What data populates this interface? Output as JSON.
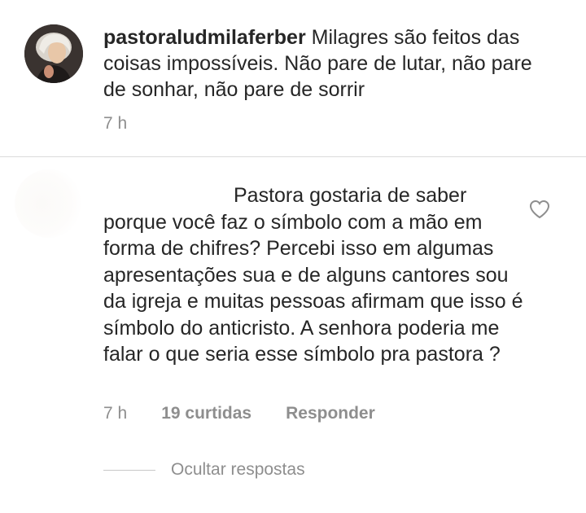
{
  "post": {
    "username": "pastoraludmilaferber",
    "caption": "Milagres são feitos das coisas impossíveis. Não pare de lutar, não pare de sonhar, não pare de sorrir",
    "time": "7 h"
  },
  "comment": {
    "text": "Pastora gostaria de saber porque você faz o símbolo com a mão em forma de chifres? Percebi isso em algumas apresentações sua e de alguns cantores sou da igreja e muitas pessoas afirmam que isso é símbolo do anticristo. A senhora poderia me falar o que seria esse símbolo pra pastora ?",
    "time": "7 h",
    "likes": "19 curtidas",
    "reply_label": "Responder",
    "hide_replies_label": "Ocultar respostas",
    "like_icon": "heart-outline-icon"
  }
}
